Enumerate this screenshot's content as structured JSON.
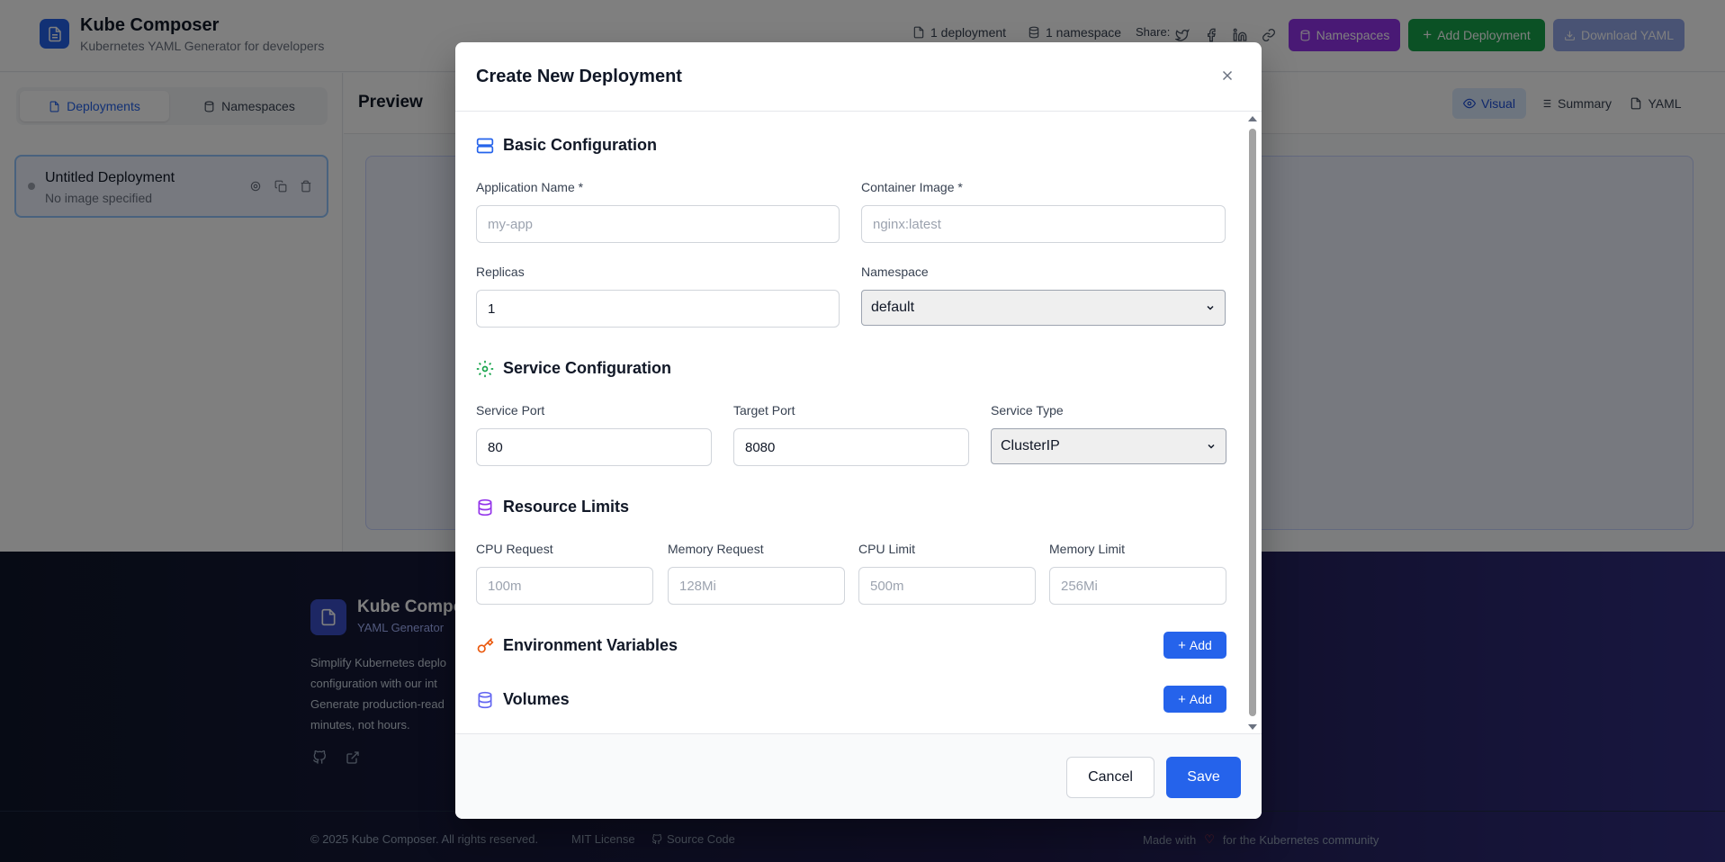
{
  "header": {
    "title": "Kube Composer",
    "subtitle": "Kubernetes YAML Generator for developers",
    "deployment_count": "1 deployment",
    "namespace_count": "1 namespace",
    "share_label": "Share:",
    "namespaces_btn": "Namespaces",
    "add_deployment_btn": "Add Deployment",
    "download_btn": "Download YAML",
    "colors": {
      "namespaces": "#9333ea",
      "add": "#16a34a",
      "download": "#93a6e8"
    }
  },
  "sidebar": {
    "tabs": [
      {
        "label": "Deployments"
      },
      {
        "label": "Namespaces"
      }
    ],
    "deployment": {
      "name": "Untitled Deployment",
      "image": "No image specified"
    }
  },
  "main": {
    "preview_title": "Preview",
    "view_tabs": [
      {
        "label": "Visual"
      },
      {
        "label": "Summary"
      },
      {
        "label": "YAML"
      }
    ]
  },
  "footer": {
    "title": "Kube Compo",
    "subtitle": "YAML Generator",
    "description": [
      "Simplify Kubernetes deplo",
      "configuration with our int",
      "Generate production-read",
      "minutes, not hours."
    ],
    "copyright": "© 2025 Kube Composer. All rights reserved.",
    "license": "MIT License",
    "source": "Source Code",
    "made_with_pre": "Made with",
    "made_with_post": "for the Kubernetes community"
  },
  "modal": {
    "title": "Create New Deployment",
    "basic": {
      "heading": "Basic Configuration",
      "app_name_label": "Application Name *",
      "app_name_placeholder": "my-app",
      "image_label": "Container Image *",
      "image_placeholder": "nginx:latest",
      "replicas_label": "Replicas",
      "replicas_value": "1",
      "namespace_label": "Namespace",
      "namespace_value": "default"
    },
    "service": {
      "heading": "Service Configuration",
      "port_label": "Service Port",
      "port_value": "80",
      "target_label": "Target Port",
      "target_value": "8080",
      "type_label": "Service Type",
      "type_value": "ClusterIP"
    },
    "resources": {
      "heading": "Resource Limits",
      "cpu_req_label": "CPU Request",
      "cpu_req_placeholder": "100m",
      "mem_req_label": "Memory Request",
      "mem_req_placeholder": "128Mi",
      "cpu_lim_label": "CPU Limit",
      "cpu_lim_placeholder": "500m",
      "mem_lim_label": "Memory Limit",
      "mem_lim_placeholder": "256Mi"
    },
    "env": {
      "heading": "Environment Variables",
      "add_label": "Add"
    },
    "volumes": {
      "heading": "Volumes",
      "add_label": "Add"
    },
    "cancel_label": "Cancel",
    "save_label": "Save"
  }
}
